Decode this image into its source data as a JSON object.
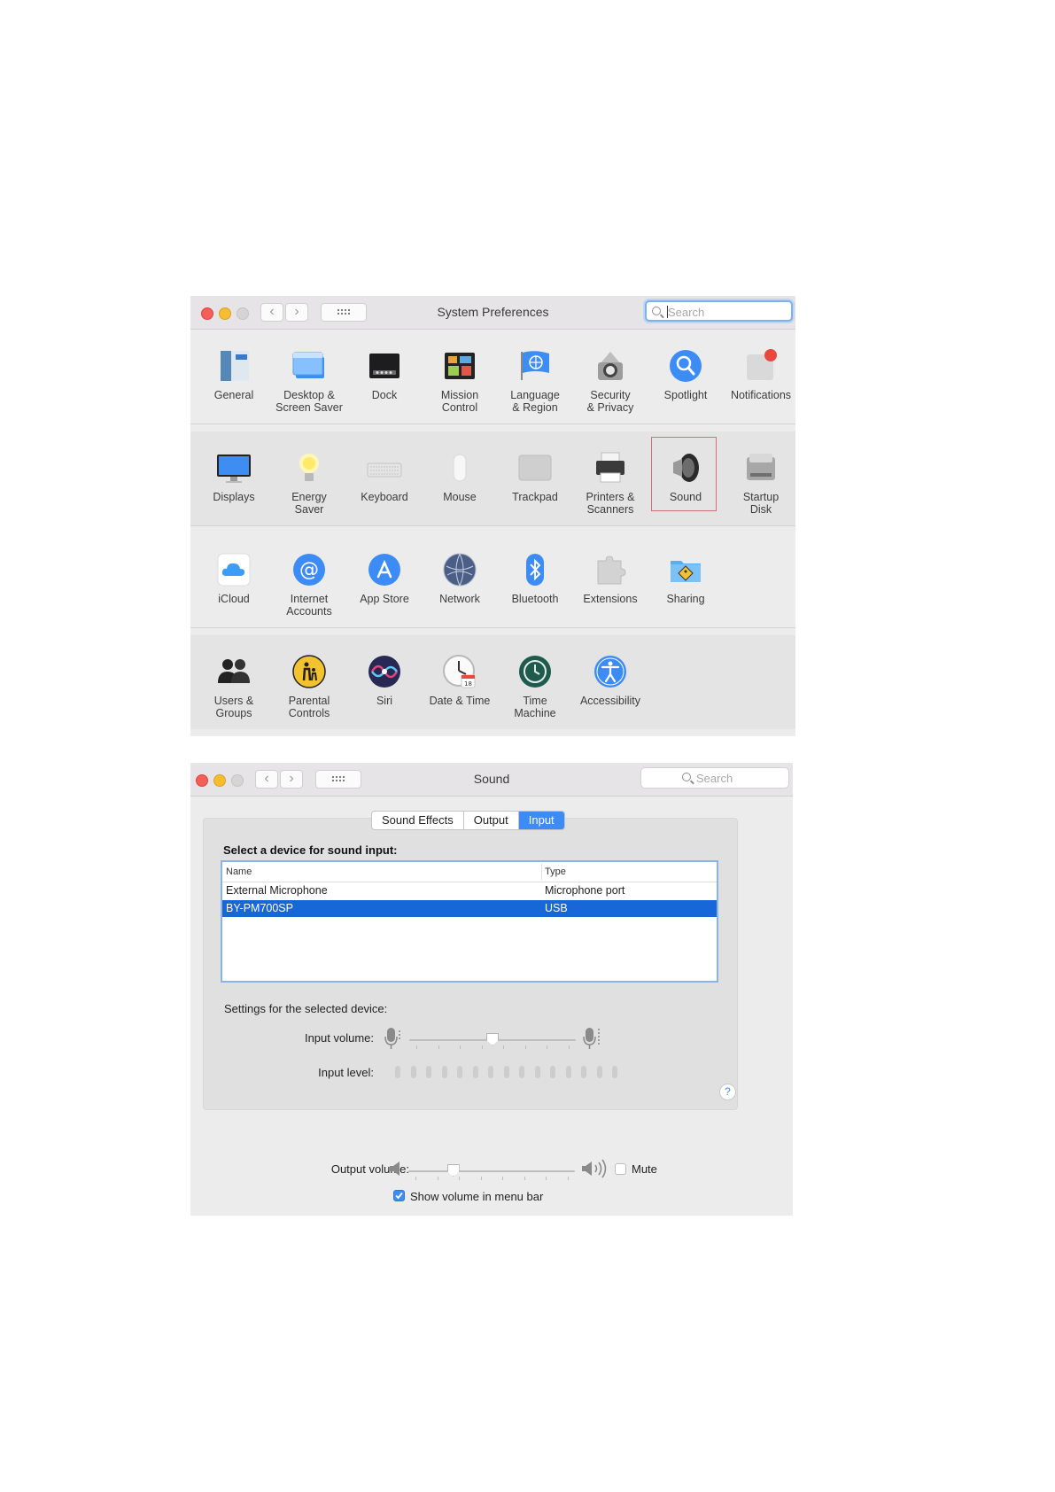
{
  "system_preferences": {
    "title": "System Preferences",
    "search_placeholder": "Search",
    "rows": [
      [
        {
          "name": "pane-general",
          "label": "General",
          "icon": "general-icon"
        },
        {
          "name": "pane-desktop",
          "label": "Desktop &\nScreen Saver",
          "icon": "desktop-icon"
        },
        {
          "name": "pane-dock",
          "label": "Dock",
          "icon": "dock-icon"
        },
        {
          "name": "pane-mission-control",
          "label": "Mission\nControl",
          "icon": "mission-control-icon"
        },
        {
          "name": "pane-language",
          "label": "Language\n& Region",
          "icon": "language-icon"
        },
        {
          "name": "pane-security",
          "label": "Security\n& Privacy",
          "icon": "security-icon"
        },
        {
          "name": "pane-spotlight",
          "label": "Spotlight",
          "icon": "spotlight-icon"
        },
        {
          "name": "pane-notifications",
          "label": "Notifications",
          "icon": "notifications-icon"
        }
      ],
      [
        {
          "name": "pane-displays",
          "label": "Displays",
          "icon": "displays-icon"
        },
        {
          "name": "pane-energy",
          "label": "Energy\nSaver",
          "icon": "energy-icon"
        },
        {
          "name": "pane-keyboard",
          "label": "Keyboard",
          "icon": "keyboard-icon"
        },
        {
          "name": "pane-mouse",
          "label": "Mouse",
          "icon": "mouse-icon"
        },
        {
          "name": "pane-trackpad",
          "label": "Trackpad",
          "icon": "trackpad-icon"
        },
        {
          "name": "pane-printers",
          "label": "Printers &\nScanners",
          "icon": "printer-icon"
        },
        {
          "name": "pane-sound",
          "label": "Sound",
          "icon": "speaker-icon",
          "selected": true
        },
        {
          "name": "pane-startup-disk",
          "label": "Startup\nDisk",
          "icon": "disk-icon"
        }
      ],
      [
        {
          "name": "pane-icloud",
          "label": "iCloud",
          "icon": "icloud-icon"
        },
        {
          "name": "pane-internet-accounts",
          "label": "Internet\nAccounts",
          "icon": "at-icon"
        },
        {
          "name": "pane-app-store",
          "label": "App Store",
          "icon": "app-store-icon"
        },
        {
          "name": "pane-network",
          "label": "Network",
          "icon": "network-icon"
        },
        {
          "name": "pane-bluetooth",
          "label": "Bluetooth",
          "icon": "bluetooth-icon"
        },
        {
          "name": "pane-extensions",
          "label": "Extensions",
          "icon": "extensions-icon"
        },
        {
          "name": "pane-sharing",
          "label": "Sharing",
          "icon": "sharing-icon"
        }
      ],
      [
        {
          "name": "pane-users",
          "label": "Users &\nGroups",
          "icon": "users-icon"
        },
        {
          "name": "pane-parental",
          "label": "Parental\nControls",
          "icon": "parental-icon"
        },
        {
          "name": "pane-siri",
          "label": "Siri",
          "icon": "siri-icon"
        },
        {
          "name": "pane-date-time",
          "label": "Date & Time",
          "icon": "clock-icon"
        },
        {
          "name": "pane-time-machine",
          "label": "Time\nMachine",
          "icon": "time-machine-icon"
        },
        {
          "name": "pane-accessibility",
          "label": "Accessibility",
          "icon": "accessibility-icon"
        }
      ]
    ]
  },
  "sound": {
    "title": "Sound",
    "search_placeholder": "Search",
    "tabs": [
      {
        "label": "Sound Effects",
        "active": false
      },
      {
        "label": "Output",
        "active": false
      },
      {
        "label": "Input",
        "active": true
      }
    ],
    "select_heading": "Select a device for sound input:",
    "table": {
      "headers": [
        "Name",
        "Type"
      ],
      "rows": [
        {
          "name": "External Microphone",
          "type": "Microphone port",
          "selected": false
        },
        {
          "name": "BY-PM700SP",
          "type": "USB",
          "selected": true
        }
      ]
    },
    "settings_heading": "Settings for the selected device:",
    "input_volume_label": "Input volume:",
    "input_volume": 0.5,
    "input_level_label": "Input level:",
    "input_level_segments": 15,
    "input_level_active": 0,
    "output_volume_label": "Output volume:",
    "output_volume": 0.27,
    "mute_label": "Mute",
    "mute_checked": false,
    "show_volume_label": "Show volume in menu bar",
    "show_volume_checked": true,
    "help_label": "?"
  },
  "colors": {
    "accent": "#3d8cf6",
    "selection": "#1767d8",
    "close": "#f45f57",
    "minimize": "#f5bd2f"
  }
}
